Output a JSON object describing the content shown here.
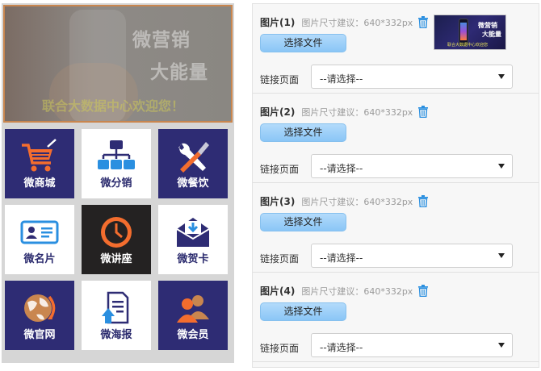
{
  "preview": {
    "banner": {
      "line1": "微营销",
      "line2": "大能量",
      "line3": "联合大数据中心欢迎您！"
    },
    "tiles": [
      {
        "label": "微商城",
        "icon": "shopping-cart-icon",
        "style": "dark"
      },
      {
        "label": "微分销",
        "icon": "org-chart-icon",
        "style": "light"
      },
      {
        "label": "微餐饮",
        "icon": "tools-icon",
        "style": "dark"
      },
      {
        "label": "微名片",
        "icon": "business-card-icon",
        "style": "light"
      },
      {
        "label": "微讲座",
        "icon": "clock-icon",
        "style": "black"
      },
      {
        "label": "微贺卡",
        "icon": "envelope-icon",
        "style": "light"
      },
      {
        "label": "微官网",
        "icon": "globe-icon",
        "style": "dark"
      },
      {
        "label": "微海报",
        "icon": "poster-upload-icon",
        "style": "light"
      },
      {
        "label": "微会员",
        "icon": "members-icon",
        "style": "dark"
      }
    ]
  },
  "config": {
    "size_hint": "图片尺寸建议：640*332px",
    "upload_label": "选择文件",
    "link_label": "链接页面",
    "select_placeholder": "--请选择--",
    "thumb": {
      "line1": "微营销",
      "line2": "大能量",
      "line3": "联合大数据中心欢迎您"
    },
    "items": [
      {
        "name": "图片(1)"
      },
      {
        "name": "图片(2)"
      },
      {
        "name": "图片(3)"
      },
      {
        "name": "图片(4)"
      }
    ]
  },
  "colors": {
    "tile_dark": "#2e2c74",
    "tile_black": "#242222",
    "accent_orange": "#f36d2e",
    "accent_blue": "#2a8fe0",
    "button_blue": "#8ac6f6"
  }
}
